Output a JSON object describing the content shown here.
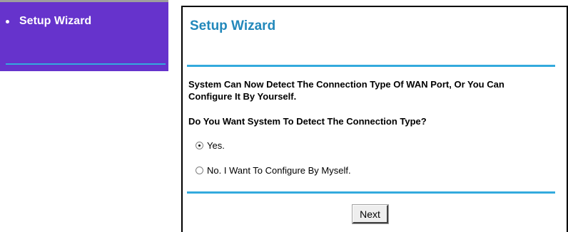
{
  "sidebar": {
    "items": [
      {
        "label": "Setup Wizard"
      }
    ]
  },
  "main": {
    "title": "Setup Wizard",
    "description": "System Can Now Detect The Connection Type Of WAN Port, Or You Can Configure It By Yourself.",
    "question": "Do You Want System To Detect The Connection Type?",
    "options": [
      {
        "label": "Yes.",
        "selected": true
      },
      {
        "label": "No. I Want To Configure By Myself.",
        "selected": false
      }
    ],
    "next_label": "Next"
  },
  "colors": {
    "sidebar_bg": "#6633cc",
    "accent": "#33aadd",
    "title": "#2288bb"
  }
}
